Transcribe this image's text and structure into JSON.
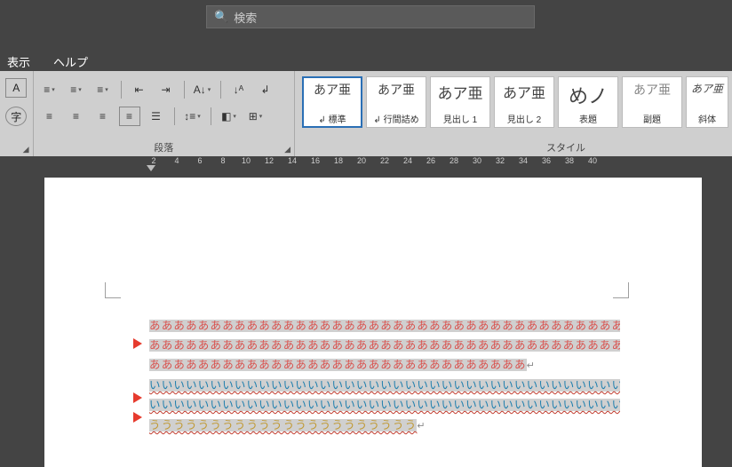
{
  "search": {
    "placeholder": "検索"
  },
  "menus": {
    "view": "表示",
    "help": "ヘルプ"
  },
  "fontGroup": {
    "boxA": "A",
    "boxAt": "字"
  },
  "paraGroup": {
    "label": "段落",
    "row1": {
      "bullets": "≡",
      "numbers": "≡",
      "multilist": "≡",
      "outdent": "⇤",
      "indent": "⇥",
      "sort": "A↓",
      "asian": "↓ᴬ",
      "marks": "↲"
    },
    "row2": {
      "left": "≡",
      "center": "≡",
      "right": "≡",
      "justify": "≡",
      "dist": "☰",
      "linesp": "↕≡",
      "shade": "◧",
      "borders": "⊞"
    }
  },
  "styleGroup": {
    "label": "スタイル",
    "items": [
      {
        "preview": "あア亜",
        "label": "↲ 標準"
      },
      {
        "preview": "あア亜",
        "label": "↲ 行間詰め"
      },
      {
        "preview": "あア亜",
        "label": "見出し 1"
      },
      {
        "preview": "あア亜",
        "label": "見出し 2"
      },
      {
        "preview": "めノ",
        "label": "表題"
      },
      {
        "preview": "あア亜",
        "label": "副題"
      },
      {
        "preview": "あア亜",
        "label": "斜体"
      }
    ]
  },
  "ruler": {
    "ticks": [
      "2",
      "4",
      "6",
      "8",
      "10",
      "12",
      "14",
      "16",
      "18",
      "20",
      "22",
      "24",
      "26",
      "28",
      "30",
      "32",
      "34",
      "36",
      "38",
      "40"
    ]
  },
  "doc": {
    "line1": "ああああああああああああああああああああああああああああああああああああああああ",
    "line2": "ああああああああああああああああああああああああああああああああああああああああ",
    "line3": "あああああああああああああああああああああああああああああああ",
    "line3_mark": "↵",
    "line4": "いいいいいいいいいいいいいいいいいいいいいいいいいいいいいいいいいいいいいいいい",
    "line5": "いいいいいいいいいいいいいいいいいいいいいいいいいいいいいいいいいいいいいいいい",
    "line5_mark": "↵",
    "line6": "うううううううううううううううううううううう",
    "line6_mark": "↵"
  }
}
